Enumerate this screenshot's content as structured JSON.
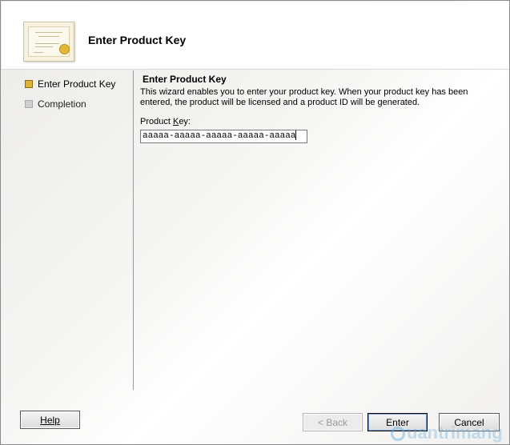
{
  "header": {
    "title": "Enter Product Key"
  },
  "steps": [
    {
      "label": "Enter Product Key",
      "state": "active"
    },
    {
      "label": "Completion",
      "state": "inactive"
    }
  ],
  "main": {
    "section_title": "Enter Product Key",
    "description": "This wizard enables you to enter your product key. When your product key has been entered, the product will be licensed and a product ID will be generated.",
    "field_label_pre": "Product ",
    "field_label_accel": "K",
    "field_label_post": "ey:",
    "product_key_value": "aaaaa-aaaaa-aaaaa-aaaaa-aaaaa"
  },
  "buttons": {
    "help": "Help",
    "back": "< Back",
    "enter": "Enter",
    "cancel": "Cancel"
  },
  "watermark": "uantrimang",
  "colors": {
    "active_step": "#e0b437",
    "inactive_step": "#cfcfcf",
    "watermark": "#5faadc"
  }
}
